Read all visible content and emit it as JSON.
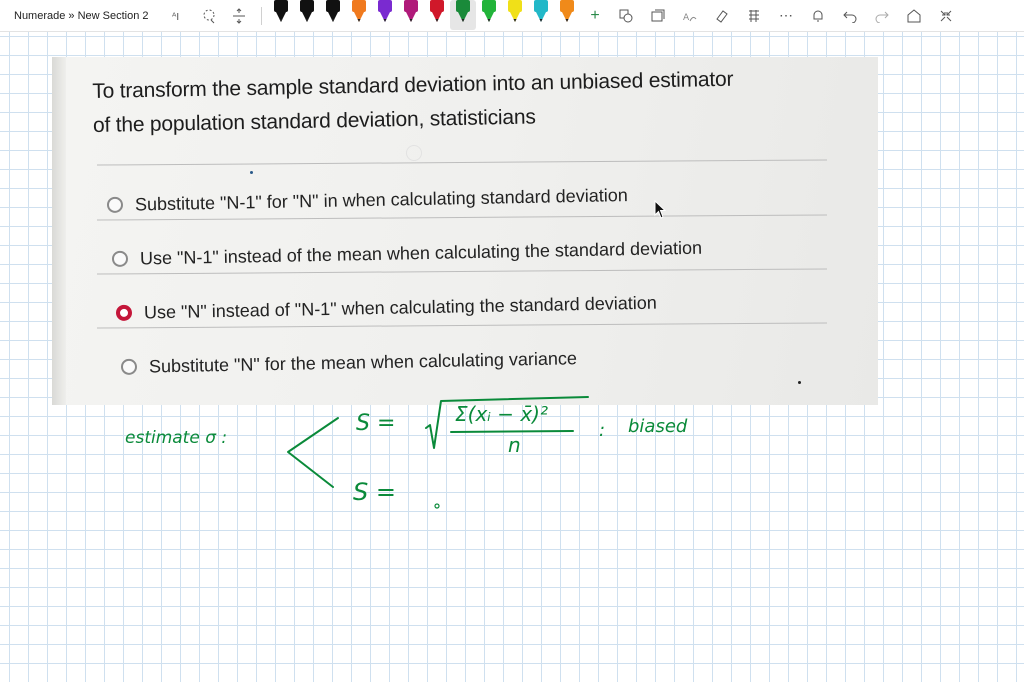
{
  "toolbar": {
    "breadcrumb": "Numerade » New Section 2",
    "pen_colors": [
      "#111111",
      "#111111",
      "#111111",
      "#f07a1f",
      "#7a2ad0",
      "#b01a7a",
      "#d0182a",
      "#1a8a3a",
      "#22b43a",
      "#f0e018",
      "#22b8c8",
      "#f08a1a"
    ],
    "selected_pen_index": 7
  },
  "question": {
    "line1": "To transform the sample standard deviation into an unbiased estimator",
    "line2": "of the population standard deviation, statisticians",
    "options": [
      {
        "label": "Substitute \"N-1\" for \"N\" in when calculating standard deviation",
        "checked": false
      },
      {
        "label": "Use \"N-1\" instead of the mean when calculating the standard deviation",
        "checked": false
      },
      {
        "label": "Use \"N\" instead of \"N-1\" when calculating the standard deviation",
        "checked": true
      },
      {
        "label": "Substitute \"N\" for the mean when calculating variance",
        "checked": false
      }
    ]
  },
  "notes": {
    "estimate_label": "estimate σ :",
    "s_eq_1": "S =",
    "numerator": "Σ(xᵢ − x̄)²",
    "denominator": "n",
    "colon": ":",
    "biased_label": "biased",
    "s_eq_2": "S ="
  },
  "ink_color": "#0a8a3a"
}
